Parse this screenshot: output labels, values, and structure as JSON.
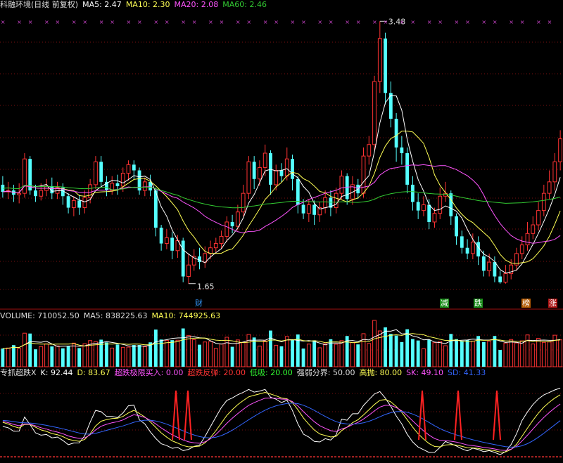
{
  "main": {
    "title": "科融环境(日线 前复权)",
    "ma5": "MA5: 2.47",
    "ma10": "MA10: 2.30",
    "ma20": "MA20: 2.08",
    "ma60": "MA60: 2.46",
    "high_label": "3.48",
    "low_label": "1.65",
    "badges": [
      "财",
      "减",
      "跌",
      "榜",
      "涨"
    ]
  },
  "volume": {
    "title": "VOLUME: 710052.50",
    "ma5": "MA5: 838225.63",
    "ma10": "MA10: 744925.63"
  },
  "kdj": {
    "title": "专抓超跌X",
    "k": "K: 92.44",
    "d": "D: 83.67",
    "buy": "超跌极限买入: 0.00",
    "rebound": "超跌反弹: 20.00",
    "low": "低吸: 20.00",
    "divide": "强弱分界: 50.00",
    "high": "高抛: 80.00",
    "sk": "SK: 49.10",
    "sd": "SD: 41.33"
  },
  "colors": {
    "up": "#ff3333",
    "down": "#54ffff",
    "ma5": "#ffffff",
    "ma10": "#ffff55",
    "ma20": "#ff55ff",
    "ma60": "#33cc33"
  },
  "chart_data": {
    "type": "candlestick",
    "price_high": 3.48,
    "price_low": 1.65,
    "candles": [
      [
        2.34,
        2.29,
        2.4,
        2.25
      ],
      [
        2.29,
        2.3,
        2.36,
        2.24
      ],
      [
        2.3,
        2.27,
        2.34,
        2.22
      ],
      [
        2.27,
        2.28,
        2.35,
        2.21
      ],
      [
        2.28,
        2.52,
        2.56,
        2.25
      ],
      [
        2.52,
        2.3,
        2.54,
        2.27
      ],
      [
        2.3,
        2.26,
        2.34,
        2.22
      ],
      [
        2.26,
        2.3,
        2.35,
        2.23
      ],
      [
        2.3,
        2.33,
        2.38,
        2.26
      ],
      [
        2.33,
        2.28,
        2.39,
        2.24
      ],
      [
        2.28,
        2.32,
        2.36,
        2.24
      ],
      [
        2.32,
        2.26,
        2.35,
        2.2
      ],
      [
        2.26,
        2.18,
        2.28,
        2.14
      ],
      [
        2.18,
        2.23,
        2.26,
        2.12
      ],
      [
        2.23,
        2.18,
        2.27,
        2.13
      ],
      [
        2.18,
        2.25,
        2.3,
        2.14
      ],
      [
        2.25,
        2.34,
        2.38,
        2.21
      ],
      [
        2.34,
        2.5,
        2.54,
        2.31
      ],
      [
        2.5,
        2.36,
        2.54,
        2.32
      ],
      [
        2.36,
        2.3,
        2.4,
        2.26
      ],
      [
        2.3,
        2.35,
        2.4,
        2.27
      ],
      [
        2.35,
        2.33,
        2.41,
        2.27
      ],
      [
        2.33,
        2.42,
        2.46,
        2.29
      ],
      [
        2.42,
        2.48,
        2.51,
        2.37
      ],
      [
        2.48,
        2.44,
        2.51,
        2.38
      ],
      [
        2.44,
        2.3,
        2.46,
        2.27
      ],
      [
        2.3,
        2.36,
        2.39,
        2.26
      ],
      [
        2.36,
        2.3,
        2.41,
        2.26
      ],
      [
        2.3,
        2.04,
        2.32,
        1.98
      ],
      [
        2.04,
        1.93,
        2.06,
        1.88
      ],
      [
        1.93,
        1.97,
        2.03,
        1.89
      ],
      [
        1.97,
        1.88,
        2.01,
        1.82
      ],
      [
        1.88,
        1.95,
        1.99,
        1.83
      ],
      [
        1.95,
        1.7,
        1.97,
        1.66
      ],
      [
        1.7,
        1.78,
        1.86,
        1.65
      ],
      [
        1.78,
        1.84,
        1.89,
        1.74
      ],
      [
        1.84,
        1.8,
        1.9,
        1.75
      ],
      [
        1.8,
        1.86,
        1.91,
        1.76
      ],
      [
        1.86,
        1.9,
        1.95,
        1.82
      ],
      [
        1.9,
        1.93,
        1.97,
        1.86
      ],
      [
        1.93,
        1.98,
        2.02,
        1.89
      ],
      [
        1.98,
        2.08,
        2.12,
        1.94
      ],
      [
        2.08,
        2.05,
        2.13,
        2.0
      ],
      [
        2.05,
        2.15,
        2.2,
        2.02
      ],
      [
        2.15,
        2.28,
        2.34,
        2.12
      ],
      [
        2.28,
        2.5,
        2.54,
        2.24
      ],
      [
        2.5,
        2.38,
        2.54,
        2.31
      ],
      [
        2.38,
        2.46,
        2.51,
        2.33
      ],
      [
        2.46,
        2.56,
        2.62,
        2.4
      ],
      [
        2.56,
        2.34,
        2.58,
        2.27
      ],
      [
        2.34,
        2.44,
        2.48,
        2.3
      ],
      [
        2.44,
        2.4,
        2.49,
        2.36
      ],
      [
        2.4,
        2.52,
        2.6,
        2.37
      ],
      [
        2.52,
        2.38,
        2.55,
        2.3
      ],
      [
        2.38,
        2.2,
        2.4,
        2.14
      ],
      [
        2.2,
        2.14,
        2.24,
        2.1
      ],
      [
        2.14,
        2.2,
        2.24,
        2.08
      ],
      [
        2.2,
        2.13,
        2.23,
        2.06
      ],
      [
        2.13,
        2.18,
        2.22,
        2.08
      ],
      [
        2.18,
        2.25,
        2.3,
        2.14
      ],
      [
        2.25,
        2.18,
        2.3,
        2.12
      ],
      [
        2.18,
        2.28,
        2.32,
        2.14
      ],
      [
        2.28,
        2.4,
        2.44,
        2.24
      ],
      [
        2.4,
        2.24,
        2.42,
        2.2
      ],
      [
        2.24,
        2.34,
        2.4,
        2.2
      ],
      [
        2.34,
        2.28,
        2.38,
        2.24
      ],
      [
        2.28,
        2.54,
        2.6,
        2.25
      ],
      [
        2.54,
        2.62,
        2.68,
        2.48
      ],
      [
        2.62,
        3.06,
        3.1,
        2.58
      ],
      [
        3.06,
        3.36,
        3.48,
        2.98
      ],
      [
        3.36,
        2.98,
        3.4,
        2.9
      ],
      [
        2.98,
        2.8,
        3.06,
        2.74
      ],
      [
        2.8,
        2.6,
        2.84,
        2.5
      ],
      [
        2.6,
        2.56,
        2.68,
        2.48
      ],
      [
        2.56,
        2.34,
        2.6,
        2.28
      ],
      [
        2.34,
        2.22,
        2.4,
        2.16
      ],
      [
        2.22,
        2.16,
        2.28,
        2.1
      ],
      [
        2.16,
        2.2,
        2.26,
        2.12
      ],
      [
        2.2,
        2.08,
        2.24,
        2.03
      ],
      [
        2.08,
        2.14,
        2.18,
        2.04
      ],
      [
        2.14,
        2.26,
        2.32,
        2.1
      ],
      [
        2.26,
        2.28,
        2.36,
        2.22
      ],
      [
        2.28,
        2.12,
        2.3,
        2.06
      ],
      [
        2.12,
        1.98,
        2.14,
        1.92
      ],
      [
        1.98,
        1.9,
        2.02,
        1.86
      ],
      [
        1.9,
        1.86,
        1.96,
        1.82
      ],
      [
        1.86,
        1.94,
        2.0,
        1.82
      ],
      [
        1.94,
        1.84,
        1.98,
        1.78
      ],
      [
        1.84,
        1.74,
        1.88,
        1.7
      ],
      [
        1.74,
        1.8,
        1.86,
        1.7
      ],
      [
        1.8,
        1.7,
        1.84,
        1.66
      ],
      [
        1.7,
        1.66,
        1.74,
        1.65
      ],
      [
        1.66,
        1.72,
        1.78,
        1.65
      ],
      [
        1.72,
        1.78,
        1.82,
        1.68
      ],
      [
        1.78,
        1.86,
        1.9,
        1.74
      ],
      [
        1.86,
        1.92,
        1.98,
        1.82
      ],
      [
        1.92,
        2.0,
        2.08,
        1.88
      ],
      [
        2.0,
        2.06,
        2.12,
        1.96
      ],
      [
        2.06,
        2.16,
        2.22,
        2.02
      ],
      [
        2.16,
        2.28,
        2.34,
        2.12
      ],
      [
        2.28,
        2.36,
        2.44,
        2.24
      ],
      [
        2.36,
        2.5,
        2.56,
        2.3
      ],
      [
        2.5,
        2.66,
        2.72,
        2.44
      ]
    ]
  }
}
